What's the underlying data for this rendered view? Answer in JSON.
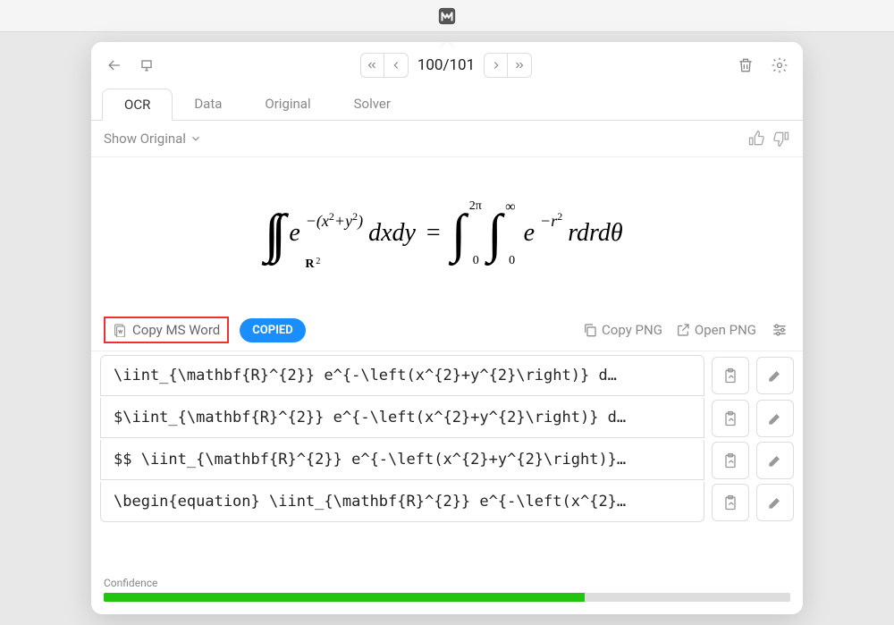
{
  "page_counter": "100/101",
  "tabs": {
    "ocr": "OCR",
    "data": "Data",
    "original": "Original",
    "solver": "Solver"
  },
  "show_original_label": "Show Original",
  "formula_rendered": "∬_R² e^-(x²+y²) dxdy = ∫₀^2π ∫₀^∞ e^-r² r dr dθ",
  "copy_word_label": "Copy MS Word",
  "copied_label": "COPIED",
  "copy_png_label": "Copy PNG",
  "open_png_label": "Open PNG",
  "code_rows": [
    "\\iint_{\\mathbf{R}^{2}} e^{-\\left(x^{2}+y^{2}\\right)} d…",
    "$\\iint_{\\mathbf{R}^{2}} e^{-\\left(x^{2}+y^{2}\\right)} d…",
    "$$ \\iint_{\\mathbf{R}^{2}} e^{-\\left(x^{2}+y^{2}\\right)}…",
    "\\begin{equation} \\iint_{\\mathbf{R}^{2}} e^{-\\left(x^{2}…"
  ],
  "confidence_label": "Confidence",
  "confidence_pct": 70
}
